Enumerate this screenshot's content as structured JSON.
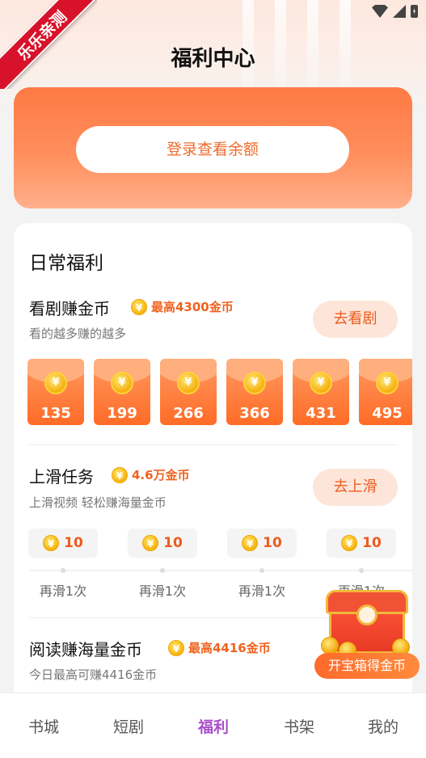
{
  "header": {
    "title": "福利中心",
    "ribbon": "乐乐亲测"
  },
  "login": {
    "button_label": "登录查看余额"
  },
  "daily": {
    "title": "日常福利",
    "watch": {
      "title": "看剧赚金币",
      "reward": "最高4300金币",
      "desc": "看的越多赚的越多",
      "button": "去看剧",
      "envelopes": [
        "135",
        "199",
        "266",
        "366",
        "431",
        "495"
      ]
    },
    "swipe": {
      "title": "上滑任务",
      "reward": "4.6万金币",
      "desc": "上滑视频 轻松赚海量金币",
      "button": "去上滑",
      "steps": [
        {
          "coins": "10",
          "label": "再滑1次"
        },
        {
          "coins": "10",
          "label": "再滑1次"
        },
        {
          "coins": "10",
          "label": "再滑1次"
        },
        {
          "coins": "10",
          "label": "再滑1次"
        }
      ]
    },
    "read": {
      "title": "阅读赚海量金币",
      "reward": "最高4416金币",
      "desc": "今日最高可赚4416金币"
    }
  },
  "treasure": {
    "button": "开宝箱得金币"
  },
  "coin_glyph": "¥",
  "nav": {
    "items": [
      "书城",
      "短剧",
      "福利",
      "书架",
      "我的"
    ],
    "active_index": 2
  },
  "colors": {
    "accent": "#ff7a45",
    "reward_text": "#f0621f",
    "nav_active": "#a94fcb"
  }
}
